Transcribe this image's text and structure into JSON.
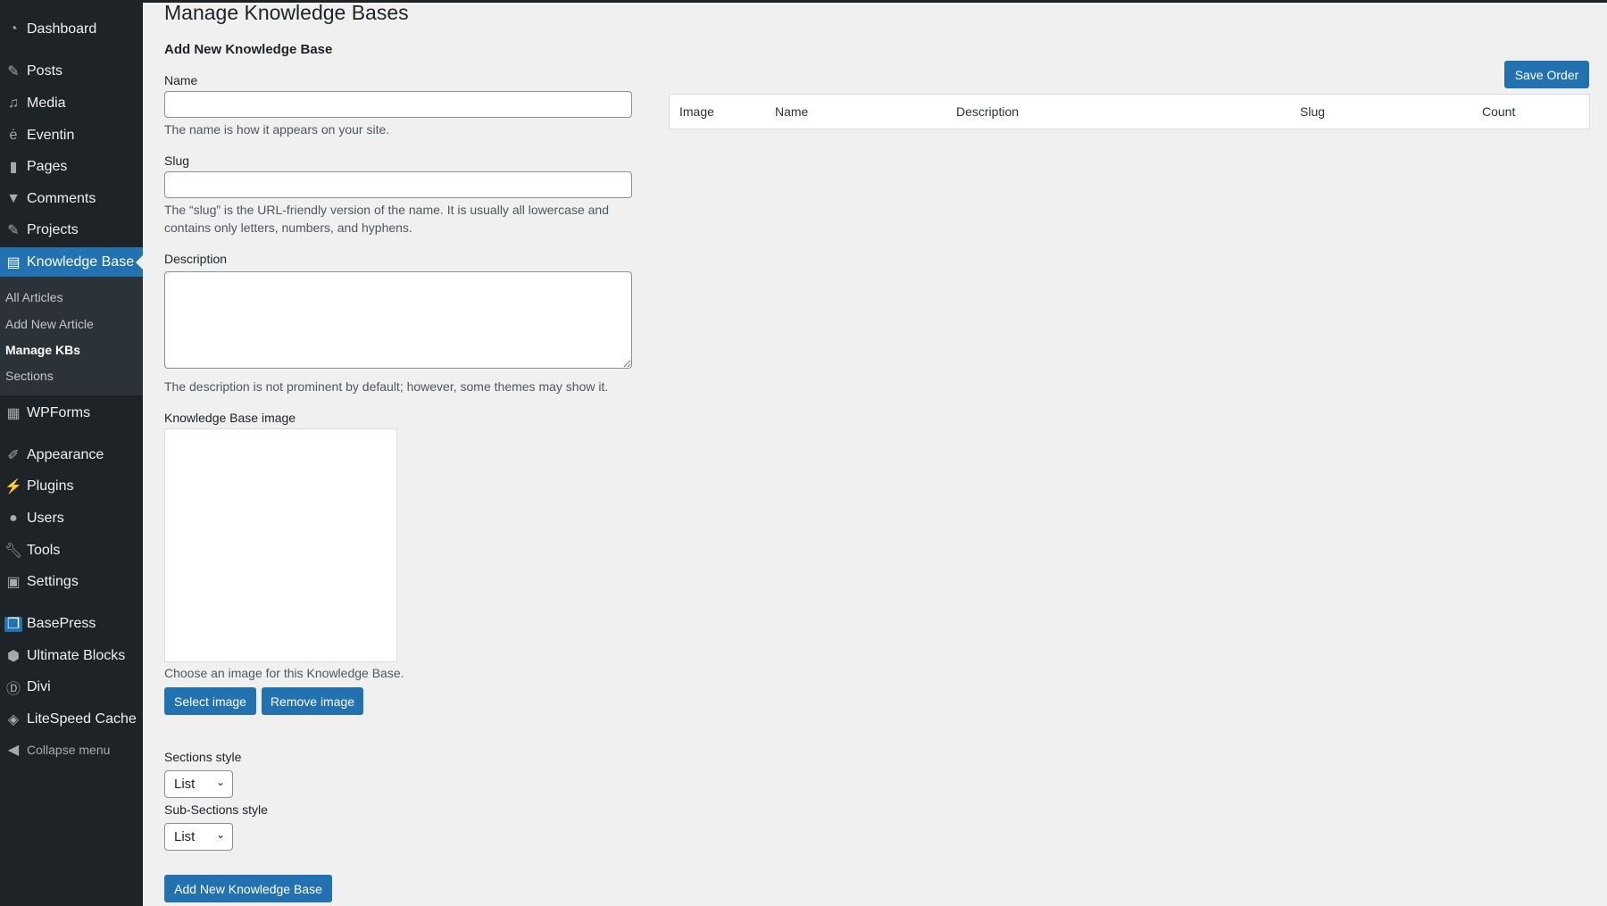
{
  "sidebar": {
    "items": [
      {
        "label": "Dashboard",
        "icon": "dashboard-icon"
      },
      {
        "label": "Posts",
        "icon": "pin-icon"
      },
      {
        "label": "Media",
        "icon": "media-icon"
      },
      {
        "label": "Eventin",
        "icon": "eventin-icon"
      },
      {
        "label": "Pages",
        "icon": "pages-icon"
      },
      {
        "label": "Comments",
        "icon": "comment-icon"
      },
      {
        "label": "Projects",
        "icon": "pin-icon"
      },
      {
        "label": "Knowledge Base",
        "icon": "document-icon"
      },
      {
        "label": "WPForms",
        "icon": "form-icon"
      },
      {
        "label": "Appearance",
        "icon": "brush-icon"
      },
      {
        "label": "Plugins",
        "icon": "plug-icon"
      },
      {
        "label": "Users",
        "icon": "user-icon"
      },
      {
        "label": "Tools",
        "icon": "wrench-icon"
      },
      {
        "label": "Settings",
        "icon": "settings-icon"
      },
      {
        "label": "BasePress",
        "icon": "book-icon"
      },
      {
        "label": "Ultimate Blocks",
        "icon": "hexagon-icon"
      },
      {
        "label": "Divi",
        "icon": "divi-icon"
      },
      {
        "label": "LiteSpeed Cache",
        "icon": "diamond-icon"
      }
    ],
    "submenu": [
      "All Articles",
      "Add New Article",
      "Manage KBs",
      "Sections"
    ],
    "collapse": "Collapse menu"
  },
  "page": {
    "title": "Manage Knowledge Bases",
    "form_title": "Add New Knowledge Base",
    "name_label": "Name",
    "name_value": "",
    "name_help": "The name is how it appears on your site.",
    "slug_label": "Slug",
    "slug_value": "",
    "slug_help": "The “slug” is the URL-friendly version of the name. It is usually all lowercase and contains only letters, numbers, and hyphens.",
    "desc_label": "Description",
    "desc_help": "The description is not prominent by default; however, some themes may show it.",
    "image_label": "Knowledge Base image",
    "image_help": "Choose an image for this Knowledge Base.",
    "select_image": "Select image",
    "remove_image": "Remove image",
    "sections_style_label": "Sections style",
    "sections_style": "List",
    "subsections_style_label": "Sub-Sections style",
    "subsections_style": "List",
    "submit": "Add New Knowledge Base"
  },
  "table": {
    "save_order": "Save Order",
    "columns": [
      "Image",
      "Name",
      "Description",
      "Slug",
      "Count"
    ]
  },
  "colors": {
    "accent": "#2271b1",
    "sidebar": "#1d2327"
  }
}
